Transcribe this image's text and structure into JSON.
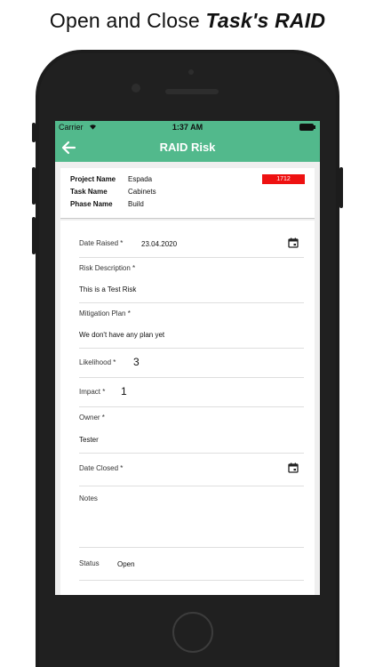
{
  "headline": {
    "prefix": "Open and Close ",
    "bold": "Task's RAID"
  },
  "statusbar": {
    "carrier": "Carrier",
    "time": "1:37 AM"
  },
  "nav": {
    "title": "RAID Risk"
  },
  "header": {
    "project_label": "Project Name",
    "project_value": "Espada",
    "task_label": "Task Name",
    "task_value": "Cabinets",
    "phase_label": "Phase Name",
    "phase_value": "Build",
    "id_badge": "1712",
    "badge_color": "#ee1111"
  },
  "form": {
    "date_raised_label": "Date Raised *",
    "date_raised_value": "23.04.2020",
    "risk_desc_label": "Risk Description *",
    "risk_desc_value": "This is a Test Risk",
    "mitigation_label": "Mitigation Plan *",
    "mitigation_value": "We don't have any plan yet",
    "likelihood_label": "Likelihood *",
    "likelihood_value": "3",
    "impact_label": "Impact *",
    "impact_value": "1",
    "owner_label": "Owner *",
    "owner_value": "Tester",
    "date_closed_label": "Date Closed *",
    "date_closed_value": "",
    "notes_label": "Notes",
    "notes_value": "",
    "status_label": "Status",
    "status_value": "Open"
  },
  "colors": {
    "accent": "#52b98c",
    "frame": "#1c1c1c"
  },
  "icons": {
    "back": "arrow-left-icon",
    "calendar": "calendar-icon",
    "wifi": "wifi-icon",
    "battery": "battery-icon"
  }
}
